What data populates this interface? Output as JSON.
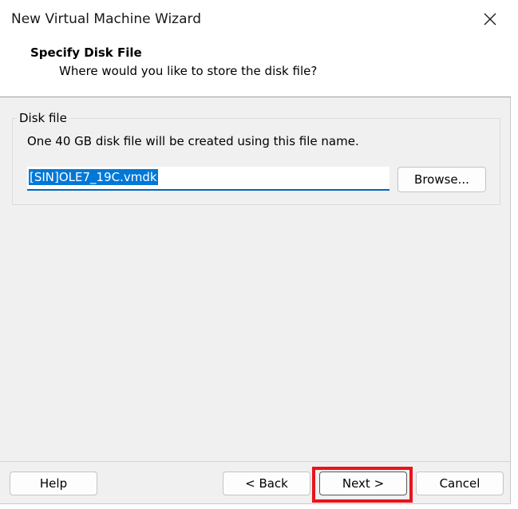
{
  "window": {
    "title": "New Virtual Machine Wizard"
  },
  "header": {
    "title": "Specify Disk File",
    "subtitle": "Where would you like to store the disk file?"
  },
  "disk_group": {
    "label": "Disk file",
    "description": "One 40 GB disk file will be created using this file name.",
    "file_name": "[SIN]OLE7_19C.vmdk",
    "browse_label": "Browse..."
  },
  "footer": {
    "help_label": "Help",
    "back_label": "< Back",
    "next_label": "Next >",
    "cancel_label": "Cancel"
  },
  "colors": {
    "selection": "#0078d7",
    "focus_underline": "#0067c0",
    "highlight_box": "#e8141b"
  },
  "icons": {
    "close": "close-icon"
  }
}
